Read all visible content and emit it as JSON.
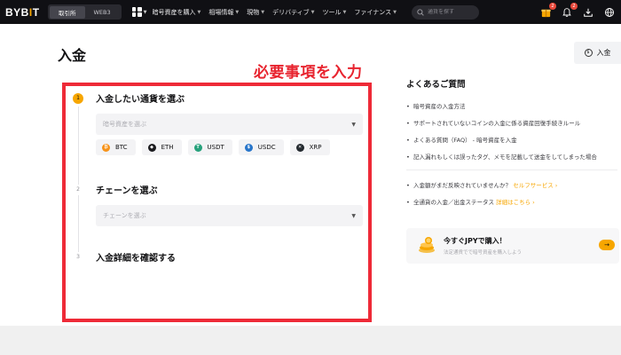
{
  "header": {
    "logo_main": "BYB",
    "logo_accent": "I",
    "logo_tail": "T",
    "segments": [
      "取引所",
      "WEB3"
    ],
    "nav": [
      "暗号資産を購入",
      "相場情報",
      "現物",
      "デリバティブ",
      "ツール",
      "ファイナンス"
    ],
    "search_placeholder": "通貨を探す",
    "badges": {
      "gift": "2",
      "bell": "2"
    }
  },
  "page": {
    "title": "入金",
    "deposit_button": "入金",
    "annotation": "必要事項を入力"
  },
  "steps": [
    {
      "number": "1",
      "title": "入金したい通貨を選ぶ",
      "select_placeholder": "暗号資産を選ぶ"
    },
    {
      "number": "2",
      "title": "チェーンを選ぶ",
      "select_placeholder": "チェーンを選ぶ"
    },
    {
      "number": "3",
      "title": "入金詳細を確認する"
    }
  ],
  "coins": [
    {
      "symbol": "BTC",
      "color": "#f7931a"
    },
    {
      "symbol": "ETH",
      "color": "#1b1b1f"
    },
    {
      "symbol": "USDT",
      "color": "#26a17b"
    },
    {
      "symbol": "USDC",
      "color": "#2775ca"
    },
    {
      "symbol": "XRP",
      "color": "#23292f"
    }
  ],
  "faq": {
    "title": "よくあるご質問",
    "items": [
      "暗号資産の入金方法",
      "サポートされていないコインの入金に係る資産回復手続きルール",
      "よくある質問（FAQ） - 暗号資産を入金",
      "記入漏れもしくは誤ったタグ、メモを記載して送金をしてしまった場合"
    ],
    "extra": [
      {
        "text": "入金額がまだ反映されていませんか？",
        "link": "セルフサービス ›"
      },
      {
        "text": "全通貨の入金／出金ステータス",
        "link": "詳細はこちら ›"
      }
    ]
  },
  "promo": {
    "title": "今すぐJPYで購入！",
    "subtitle": "法定通貨でで暗号資産を購入しよう",
    "arrow": "→"
  },
  "colors": {
    "accent": "#f7a600",
    "annotation_red": "#ee2a37"
  }
}
